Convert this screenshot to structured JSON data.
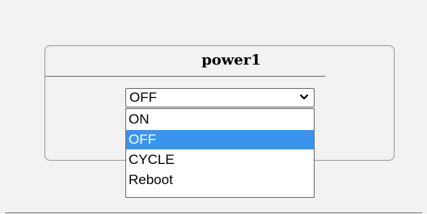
{
  "panel": {
    "title": "power1"
  },
  "select": {
    "value": "OFF",
    "options": [
      "ON",
      "OFF",
      "CYCLE",
      "Reboot"
    ],
    "highlighted_option": "OFF",
    "highlight_color": "#3b94ec"
  }
}
